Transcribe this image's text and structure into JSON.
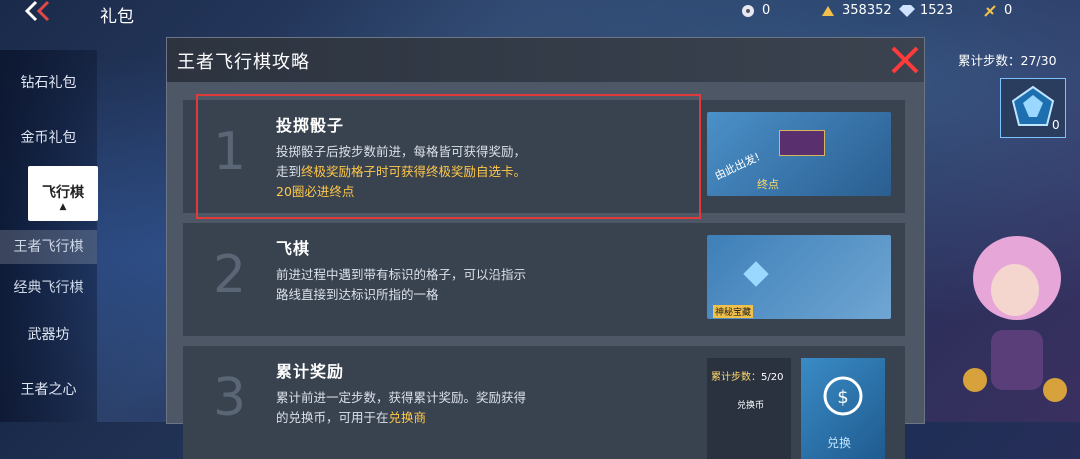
{
  "header": {
    "title": "礼包",
    "resources": [
      {
        "icon": "dice-token-icon",
        "value": "0"
      },
      {
        "icon": "gold-coin-icon",
        "value": "358352"
      },
      {
        "icon": "diamond-icon",
        "value": "1523"
      },
      {
        "icon": "plus-currency-icon",
        "value": "0"
      }
    ]
  },
  "sidebar": {
    "items": [
      {
        "label": "钻石礼包"
      },
      {
        "label": "金币礼包"
      },
      {
        "label": "飞行棋"
      },
      {
        "label": "王者飞行棋"
      },
      {
        "label": "经典飞行棋"
      },
      {
        "label": "武器坊"
      },
      {
        "label": "王者之心"
      }
    ]
  },
  "panel": {
    "title": "王者飞行棋攻略",
    "cards": [
      {
        "num": "1",
        "title": "投掷骰子",
        "desc_a": "投掷骰子后按步数前进，每格皆可获得奖励，走到",
        "desc_hl": "终极奖励格子时可获得终极奖励自选卡。20圈必进终点",
        "thumb_text_a": "由此出发!",
        "thumb_text_b": "终点"
      },
      {
        "num": "2",
        "title": "飞棋",
        "desc": "前进过程中遇到带有标识的格子，可以沿指示路线直接到达标识所指的一格",
        "thumb_text": "神秘宝藏"
      },
      {
        "num": "3",
        "title": "累计奖励",
        "desc_a": "累计前进一定步数，获得累计奖励。奖励获得的兑换币，可用于在",
        "desc_hl": "兑换商",
        "thumb_label": "累计步数：",
        "thumb_value": "5/20",
        "thumb_coin": "兑换币",
        "thumb_exchange": "兑换"
      }
    ]
  },
  "right": {
    "steps_label": "累计步数：",
    "steps_value": "27/30",
    "box_count": "0"
  },
  "colors": {
    "highlight": "#ffc84a",
    "box_border": "#e03a3a"
  }
}
